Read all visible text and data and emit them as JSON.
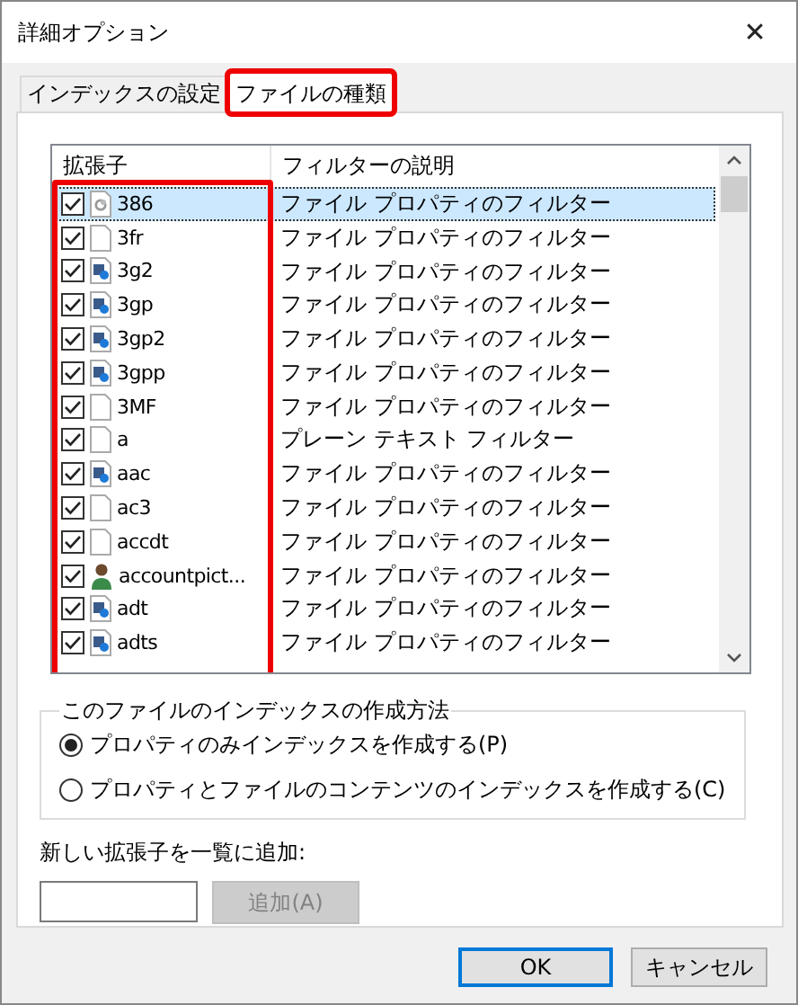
{
  "window": {
    "title": "詳細オプション",
    "close": "✕"
  },
  "tabs": [
    {
      "label": "インデックスの設定",
      "selected": false,
      "highlighted": false
    },
    {
      "label": "ファイルの種類",
      "selected": true,
      "highlighted": true
    }
  ],
  "table": {
    "columns": [
      "拡張子",
      "フィルターの説明"
    ],
    "highlight_first_column": true,
    "rows": [
      {
        "ext": "386",
        "kind": "settings",
        "checked": true,
        "selected": true,
        "filter": "ファイル プロパティのフィルター"
      },
      {
        "ext": "3fr",
        "kind": "blank",
        "checked": true,
        "selected": false,
        "filter": "ファイル プロパティのフィルター"
      },
      {
        "ext": "3g2",
        "kind": "media",
        "checked": true,
        "selected": false,
        "filter": "ファイル プロパティのフィルター"
      },
      {
        "ext": "3gp",
        "kind": "media",
        "checked": true,
        "selected": false,
        "filter": "ファイル プロパティのフィルター"
      },
      {
        "ext": "3gp2",
        "kind": "media",
        "checked": true,
        "selected": false,
        "filter": "ファイル プロパティのフィルター"
      },
      {
        "ext": "3gpp",
        "kind": "media",
        "checked": true,
        "selected": false,
        "filter": "ファイル プロパティのフィルター"
      },
      {
        "ext": "3MF",
        "kind": "blank",
        "checked": true,
        "selected": false,
        "filter": "ファイル プロパティのフィルター"
      },
      {
        "ext": "a",
        "kind": "blank",
        "checked": true,
        "selected": false,
        "filter": "プレーン テキスト フィルター"
      },
      {
        "ext": "aac",
        "kind": "media",
        "checked": true,
        "selected": false,
        "filter": "ファイル プロパティのフィルター"
      },
      {
        "ext": "ac3",
        "kind": "blank",
        "checked": true,
        "selected": false,
        "filter": "ファイル プロパティのフィルター"
      },
      {
        "ext": "accdt",
        "kind": "blank",
        "checked": true,
        "selected": false,
        "filter": "ファイル プロパティのフィルター"
      },
      {
        "ext": "accountpict...",
        "kind": "user",
        "checked": true,
        "selected": false,
        "filter": "ファイル プロパティのフィルター"
      },
      {
        "ext": "adt",
        "kind": "media",
        "checked": true,
        "selected": false,
        "filter": "ファイル プロパティのフィルター"
      },
      {
        "ext": "adts",
        "kind": "media",
        "checked": true,
        "selected": false,
        "filter": "ファイル プロパティのフィルター"
      }
    ]
  },
  "index_method": {
    "title": "このファイルのインデックスの作成方法",
    "options": [
      {
        "label": "プロパティのみインデックスを作成する(P)",
        "selected": true
      },
      {
        "label": "プロパティとファイルのコンテンツのインデックスを作成する(C)",
        "selected": false
      }
    ]
  },
  "add_extension": {
    "label": "新しい拡張子を一覧に追加:",
    "button": "追加(A)",
    "button_disabled": true
  },
  "buttons": [
    {
      "label": "OK",
      "default": true
    },
    {
      "label": "キャンセル",
      "default": false
    }
  ]
}
